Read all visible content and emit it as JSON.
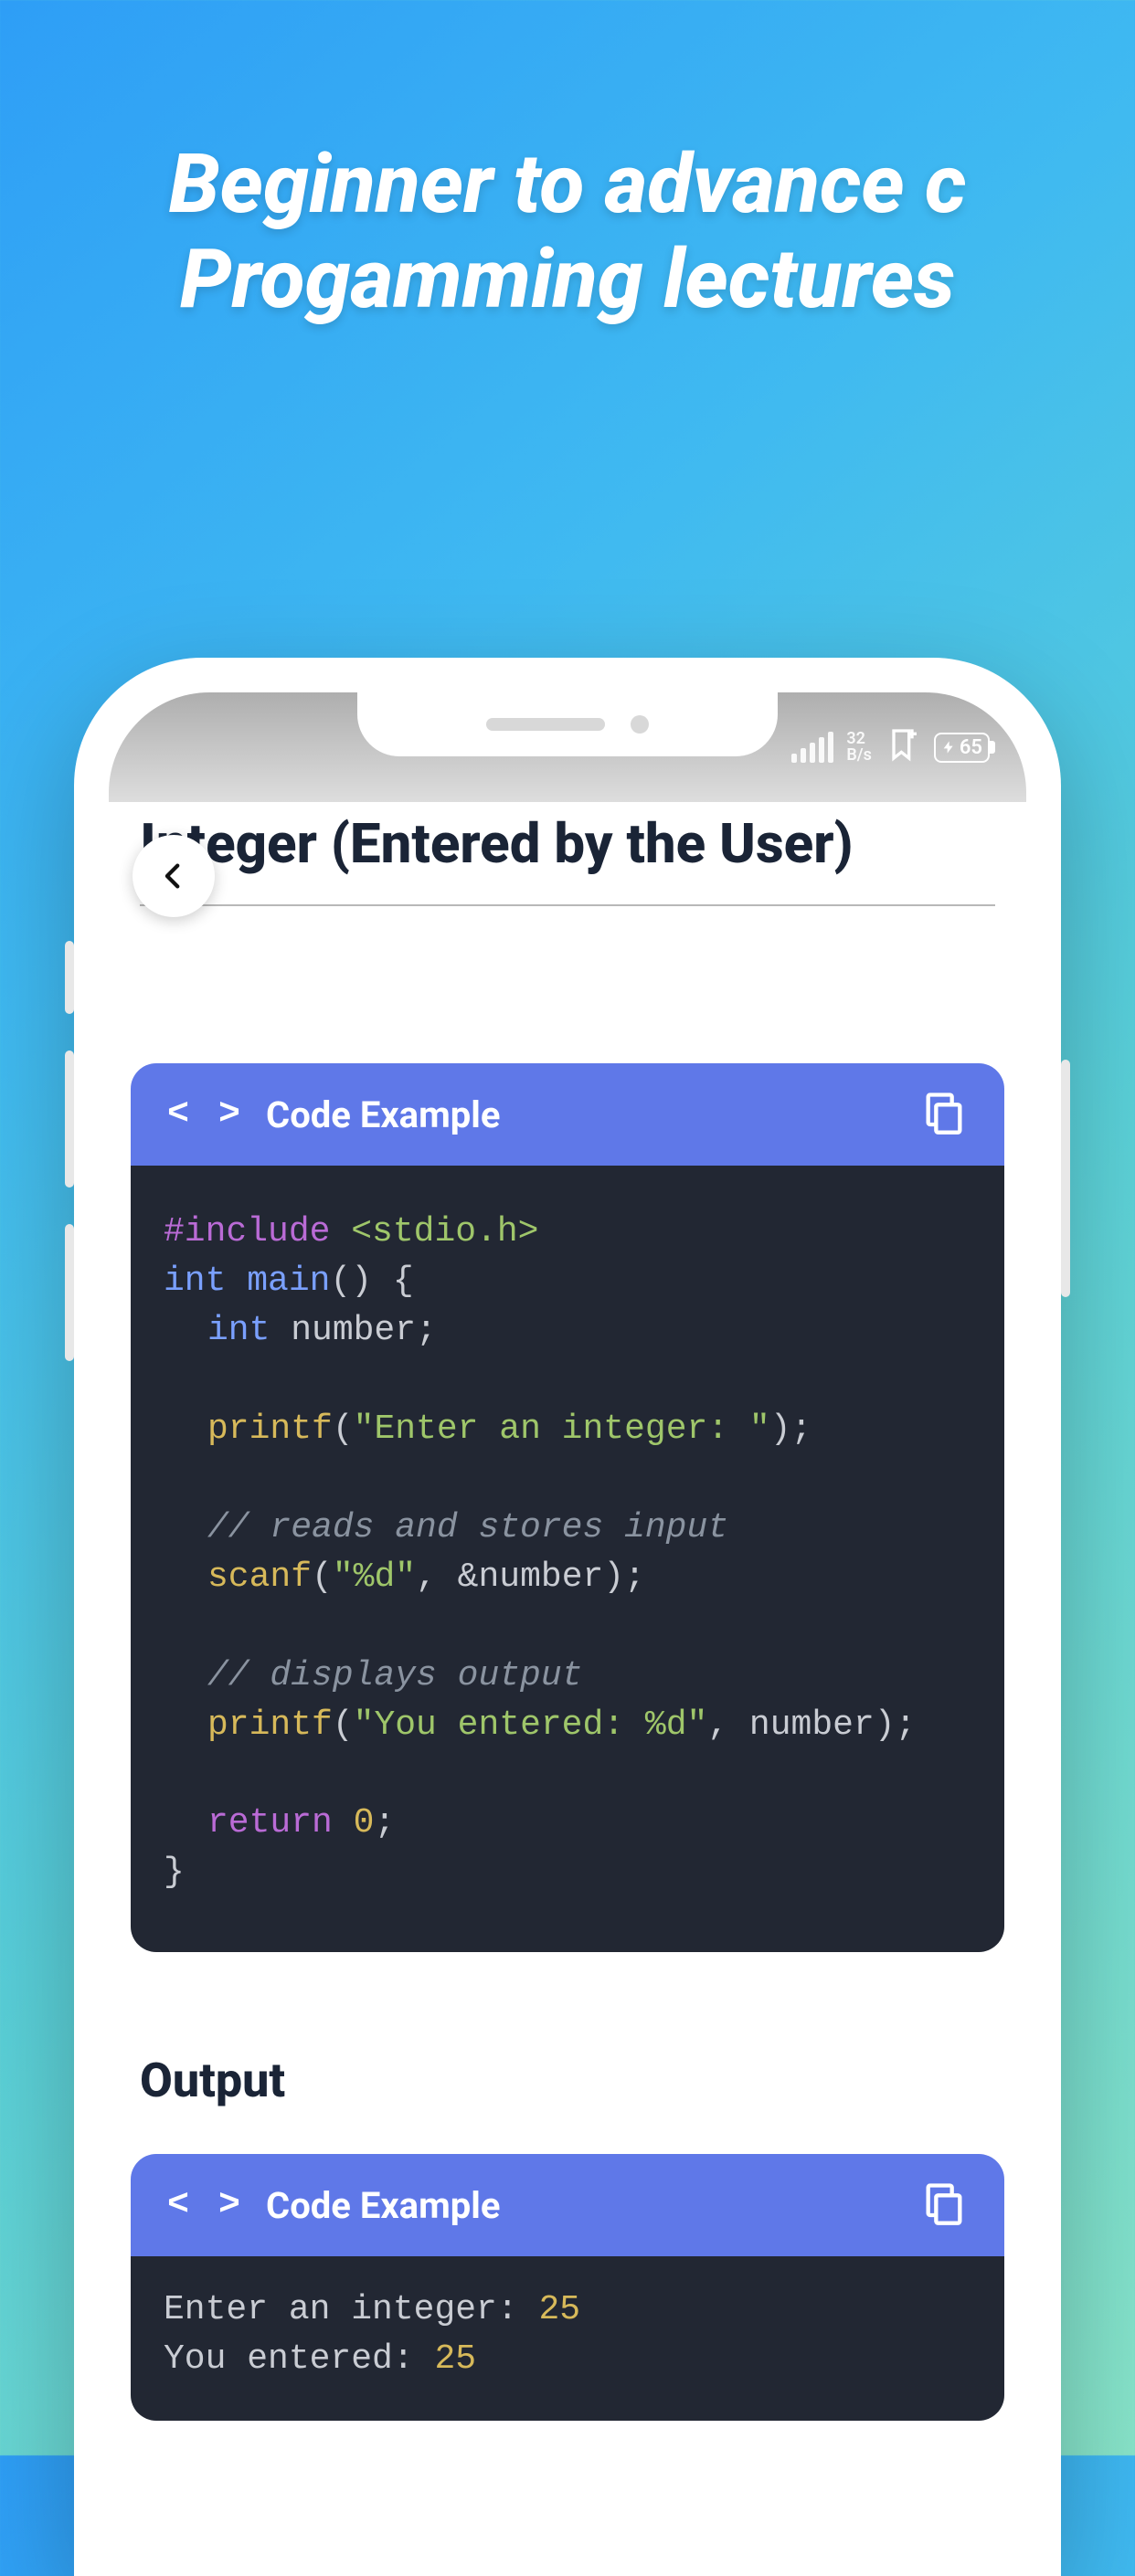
{
  "headline": "Beginner to advance c Progamming lectures",
  "status": {
    "net_top": "32",
    "net_bottom": "B/s",
    "battery": "65"
  },
  "page": {
    "title": "Integer (Entered by the User)"
  },
  "code_block1": {
    "header_label": "Code Example",
    "lines": {
      "pp_dir": "#include ",
      "pp_file": "<stdio.h>",
      "int_kw": "int ",
      "main_name": "main",
      "main_tail": "() {",
      "int_kw2": "int ",
      "number_ident": "number;",
      "printf1_call": "printf",
      "printf1_open": "(",
      "printf1_str": "\"Enter an integer: \"",
      "printf1_close": ");",
      "comment1": "// reads and stores input",
      "scanf_call": "scanf",
      "scanf_open": "(",
      "scanf_str": "\"%d\"",
      "scanf_tail": ", &number);",
      "comment2": "// displays output",
      "printf2_call": "printf",
      "printf2_open": "(",
      "printf2_str": "\"You entered: %d\"",
      "printf2_tail": ", number);",
      "return_kw": "return ",
      "return_val": "0",
      "return_tail": ";",
      "close_brace": "}"
    }
  },
  "output": {
    "heading": "Output"
  },
  "code_block2": {
    "header_label": "Code Example",
    "lines": {
      "l1_text": "Enter an integer: ",
      "l1_val": "25",
      "l2_text": "You entered: ",
      "l2_val": "25"
    }
  }
}
